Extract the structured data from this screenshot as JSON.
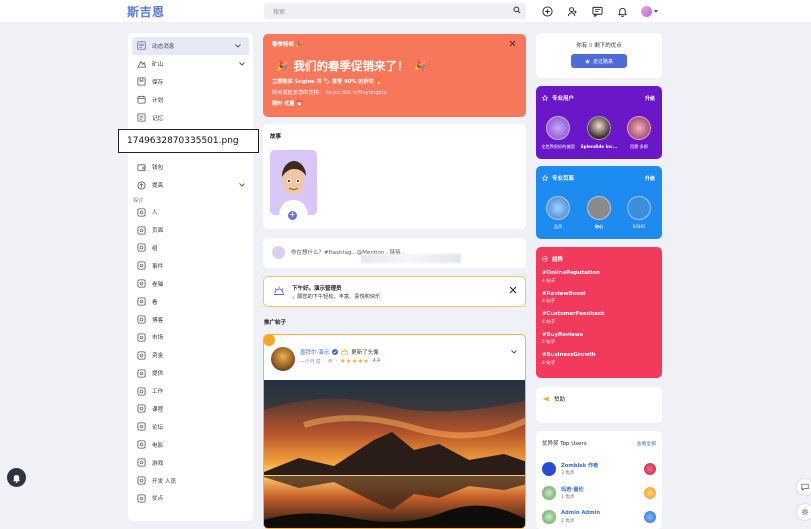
{
  "header": {
    "logo": "斯吉恩",
    "search_placeholder": "搜索"
  },
  "sidebar": {
    "items": [
      {
        "label": "动态消息",
        "icon": "newsfeed-icon"
      },
      {
        "label": "矿山",
        "icon": "mine-icon"
      },
      {
        "label": "保存",
        "icon": "bookmark-icon"
      },
      {
        "label": "计划",
        "icon": "calendar-icon"
      },
      {
        "label": "记忆",
        "icon": "memories-icon"
      }
    ],
    "items2": [
      {
        "label": "钱包",
        "icon": "wallet-icon"
      },
      {
        "label": "提高",
        "icon": "boost-icon"
      }
    ],
    "section_explore": "探讨",
    "explore": [
      {
        "label": "人",
        "icon": "people-icon"
      },
      {
        "label": "页面",
        "icon": "flag-icon"
      },
      {
        "label": "组",
        "icon": "group-icon"
      },
      {
        "label": "事件",
        "icon": "event-icon"
      },
      {
        "label": "卷轴",
        "icon": "reels-icon"
      },
      {
        "label": "看",
        "icon": "watch-icon"
      },
      {
        "label": "博客",
        "icon": "blog-icon"
      },
      {
        "label": "市场",
        "icon": "market-icon"
      },
      {
        "label": "资金",
        "icon": "funding-icon"
      },
      {
        "label": "提供",
        "icon": "offers-icon"
      },
      {
        "label": "工作",
        "icon": "jobs-icon"
      },
      {
        "label": "课程",
        "icon": "courses-icon"
      },
      {
        "label": "论坛",
        "icon": "forum-icon"
      },
      {
        "label": "电影",
        "icon": "movies-icon"
      },
      {
        "label": "游戏",
        "icon": "games-icon"
      },
      {
        "label": "开发 人员",
        "icon": "developers-icon"
      },
      {
        "label": "优点",
        "icon": "points-icon"
      }
    ]
  },
  "tooltip": "1749632870335501.png",
  "promo": {
    "tag": "春季特卖",
    "headline": "我们的春季促销来了！",
    "line1": "立即购买 Sngine 并",
    "line1b": "享受 90% 的折扣",
    "line2": "购买或延长您的支持：",
    "line2_link": "https://bit.ly/BuySngine",
    "line3": "限时 优惠"
  },
  "stories": {
    "title": "故事"
  },
  "composer": {
    "prompt": "你在想什么？#Hashtag.. @Mention.. 链接.."
  },
  "alert": {
    "title": "下午好。演示管理员",
    "text": "，願您的下午轻松、丰富、喜悦和快乐"
  },
  "promoted": {
    "title": "推广帖子",
    "author": "墨拜尔·演示",
    "action": "更新了头像",
    "time": "一个月 前",
    "stars": "★★★★★",
    "rating": "4.4"
  },
  "points": {
    "text_pre": "你有",
    "amount": "0",
    "text_post": "剩下的优点",
    "button": "走过路来"
  },
  "pro_users": {
    "title": "专业用户",
    "more": "升级",
    "users": [
      {
        "name": "全世界很好的美国"
      },
      {
        "name": "Splendide Inc..."
      },
      {
        "name": "西蒙·多斯"
      }
    ]
  },
  "pro_pages": {
    "title": "专业页面",
    "more": "升级",
    "pages": [
      {
        "name": "品声"
      },
      {
        "name": "你心"
      },
      {
        "name": "SOHO"
      }
    ]
  },
  "trending": {
    "title": "趋势",
    "tags": [
      {
        "tag": "#OnlineReputation",
        "count": "4 帖子"
      },
      {
        "tag": "#ReviewBoost",
        "count": "4 帖子"
      },
      {
        "tag": "#CustomerFeedback",
        "count": "4 帖子"
      },
      {
        "tag": "#BuyReviews",
        "count": "4 帖子"
      },
      {
        "tag": "#BusinessGrowth",
        "count": "4 帖子"
      }
    ]
  },
  "sponsored": {
    "title": "赞助"
  },
  "top_users": {
    "title": "优异奖 Top Users",
    "see_all": "查看全部",
    "users": [
      {
        "name": "Zomblek 作者",
        "points": "3 优点"
      },
      {
        "name": "玛若·嘉伦",
        "points": "1 优点"
      },
      {
        "name": "Admin Admin",
        "points": "2 优点"
      }
    ]
  },
  "colors": {
    "accent": "#5b78d8",
    "promo": "#f7775a",
    "pro_users": "#6a17c9",
    "pro_pages": "#1e8bf0",
    "trending": "#f23b5c"
  }
}
